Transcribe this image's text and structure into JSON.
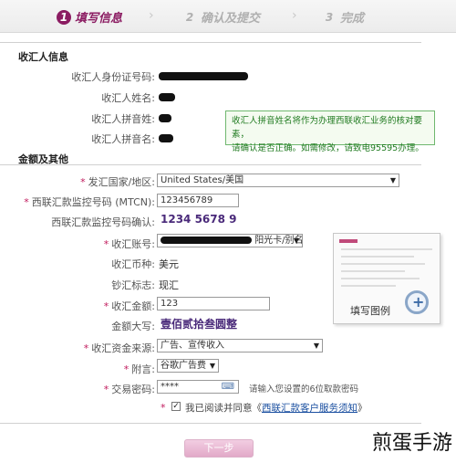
{
  "steps": [
    {
      "num": "1",
      "label": "填写信息"
    },
    {
      "num": "2",
      "label": "确认及提交"
    },
    {
      "num": "3",
      "label": "完成"
    }
  ],
  "arrows": [
    "›",
    "›"
  ],
  "sections": {
    "recipient": "收汇人信息",
    "amount": "金额及其他"
  },
  "recipient": {
    "id_label": "收汇人身份证号码:",
    "name_label": "收汇人姓名:",
    "surname_pinyin_label": "收汇人拼音姓:",
    "given_pinyin_label": "收汇人拼音名:"
  },
  "tip": {
    "line1": "收汇人拼音姓名将作为办理西联收汇业务的核对要素，",
    "line2": "请确认是否正确。如需修改，请致电95595办理。"
  },
  "form": {
    "required_mark": "*",
    "country_label": "发汇国家/地区:",
    "country_value": "United States/美国",
    "mtcn_label": "西联汇款监控号码 (MTCN):",
    "mtcn_value": "123456789",
    "mtcn_confirm_label": "西联汇款监控号码确认:",
    "mtcn_confirm_value": "1234 5678 9",
    "account_label": "收汇账号:",
    "account_suffix": "阳光卡/别名",
    "currency_label": "收汇币种:",
    "currency_value": "美元",
    "cash_flag_label": "钞汇标志:",
    "cash_flag_value": "现汇",
    "amount_label": "收汇金额:",
    "amount_value": "123",
    "amount_upper_label": "金额大写:",
    "amount_upper_value": "壹佰贰拾叁圆整",
    "source_label": "收汇资金来源:",
    "source_value": "广告、宣传收入",
    "note_label": "附言:",
    "note_value": "谷歌广告费",
    "password_label": "交易密码:",
    "password_value": "****",
    "password_hint": "请输入您设置的6位取款密码",
    "agree_prefix": "我已阅读并同意《",
    "agree_link": "西联汇款客户服务须知",
    "agree_suffix": "》",
    "checkbox_mark": "✓",
    "next_button": "下一步"
  },
  "thumbnail": {
    "caption": "填写图例",
    "zoom_glyph": "+"
  },
  "watermark": "煎蛋手游",
  "icons": {
    "select_caret": "▼",
    "keyboard_icon": "⌨"
  },
  "colors": {
    "accent": "#8b1c62",
    "tip_border": "#6fb86f",
    "tip_text": "#1f7a1f",
    "amount_purple": "#4a2a7a",
    "link": "#1a4fa0"
  }
}
